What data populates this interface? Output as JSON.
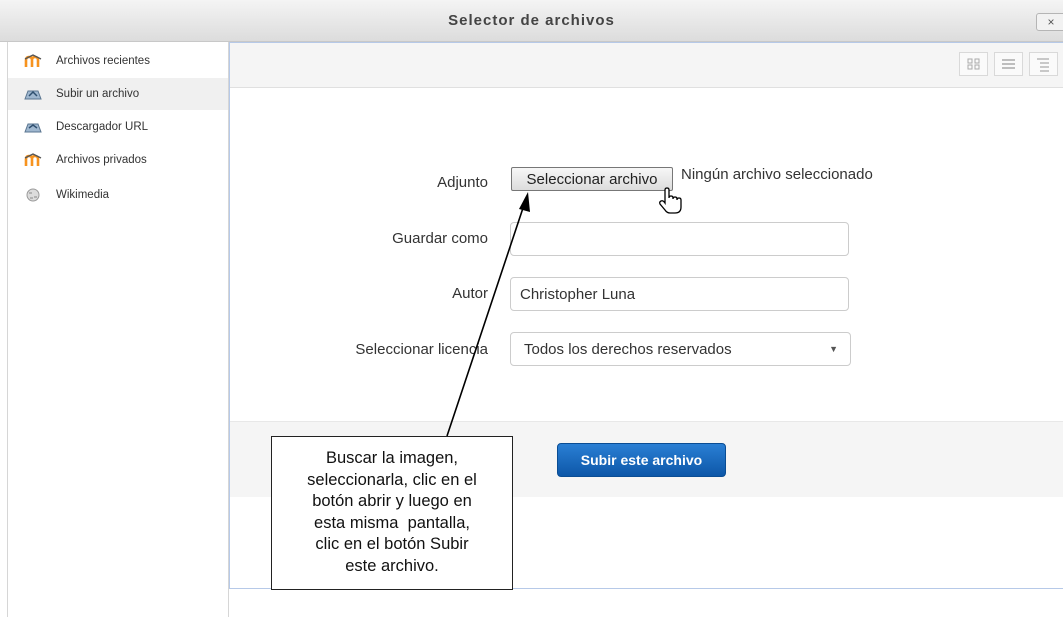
{
  "window": {
    "title": "Selector de archivos",
    "close_label": "×"
  },
  "sidebar": {
    "items": [
      {
        "label": "Archivos recientes",
        "icon": "moodle-icon"
      },
      {
        "label": "Subir un archivo",
        "icon": "upload-repository-icon"
      },
      {
        "label": "Descargador URL",
        "icon": "url-repository-icon"
      },
      {
        "label": "Archivos privados",
        "icon": "moodle-icon"
      },
      {
        "label": "Wikimedia",
        "icon": "wikimedia-icon"
      }
    ],
    "active_index": 1
  },
  "toolbar": {
    "view_buttons": [
      "icons-view-icon",
      "list-view-icon",
      "tree-view-icon"
    ]
  },
  "form": {
    "attachment_label": "Adjunto",
    "choose_file_label": "Seleccionar archivo",
    "file_status": "Ningún archivo seleccionado",
    "save_as_label": "Guardar como",
    "save_as_value": "",
    "author_label": "Autor",
    "author_value": "Christopher Luna",
    "license_label": "Seleccionar licencia",
    "license_value": "Todos los derechos reservados"
  },
  "upload_button_label": "Subir este archivo",
  "callout": {
    "lines": [
      "Buscar la imagen,",
      "seleccionarla, clic en el",
      "botón abrir y luego en",
      "esta misma  pantalla,",
      "clic en el botón Subir",
      "este archivo."
    ]
  },
  "colors": {
    "primary_button": "#0d57a8",
    "panel_border": "#b6c9e8",
    "moodle_orange": "#f7931e"
  }
}
